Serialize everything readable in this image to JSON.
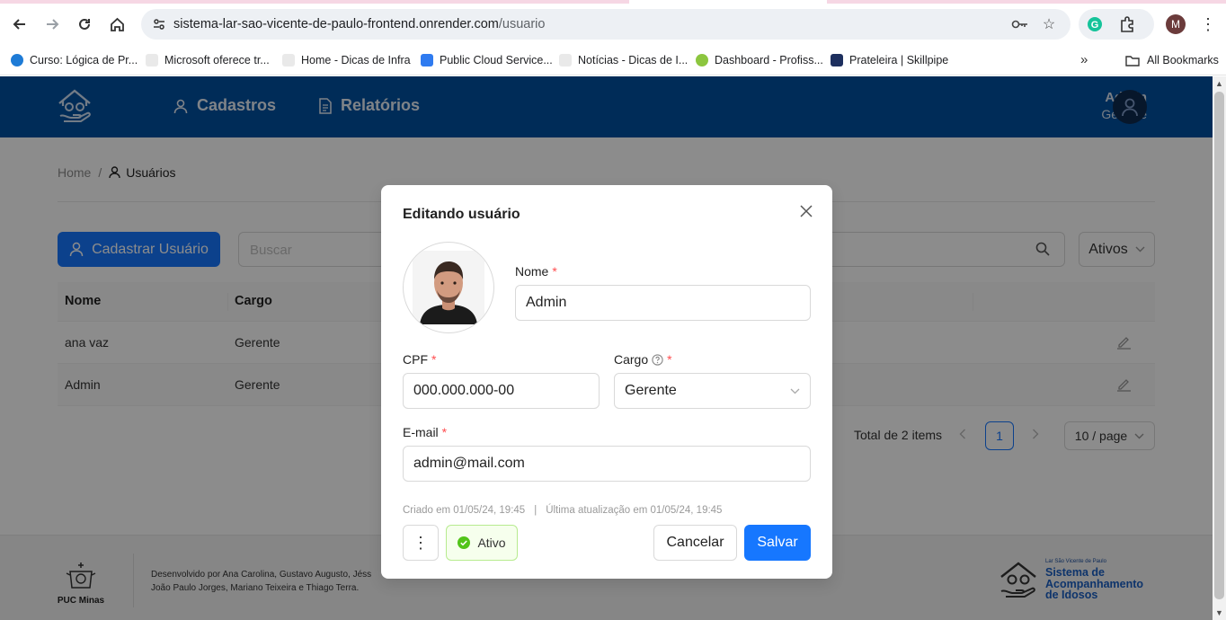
{
  "browser": {
    "url_host": "sistema-lar-sao-vicente-de-paulo-frontend.onrender.com",
    "url_path": "/usuario",
    "profile_initial": "M",
    "bookmarks": [
      {
        "label": "Curso: Lógica de Pr...",
        "color": "#1e7bd6"
      },
      {
        "label": "Microsoft oferece tr...",
        "color": "#e9e9e9"
      },
      {
        "label": "Home - Dicas de Infra",
        "color": "#e9e9e9"
      },
      {
        "label": "Public Cloud Service...",
        "color": "#2f7bf0"
      },
      {
        "label": "Notícias - Dicas de I...",
        "color": "#e9e9e9"
      },
      {
        "label": "Dashboard - Profiss...",
        "color": "#8cc63f"
      },
      {
        "label": "Prateleira | Skillpipe",
        "color": "#1d2f5e"
      }
    ],
    "more_bookmarks": "»",
    "all_bookmarks": "All Bookmarks"
  },
  "header": {
    "nav": [
      {
        "label": "Cadastros"
      },
      {
        "label": "Relatórios"
      }
    ],
    "user_name": "Admin",
    "user_role": "Gerente"
  },
  "breadcrumb": {
    "home": "Home",
    "sep": "/",
    "current": "Usuários"
  },
  "toolbar": {
    "add_label": "Cadastrar Usuário",
    "search_placeholder": "Buscar",
    "filter_value": "Ativos"
  },
  "table": {
    "columns": [
      "Nome",
      "Cargo"
    ],
    "rows": [
      {
        "nome": "ana vaz",
        "cargo": "Gerente"
      },
      {
        "nome": "Admin",
        "cargo": "Gerente"
      }
    ]
  },
  "pagination": {
    "total": "Total de 2 items",
    "current_page": "1",
    "page_size": "10 / page"
  },
  "footer": {
    "puc_label": "PUC Minas",
    "credits_line1": "Desenvolvido por Ana Carolina, Gustavo Augusto, Jéss",
    "credits_line2": "João Paulo Jorges, Mariano Teixeira e Thiago Terra.",
    "brand_small": "Lar São Vicente de Paulo",
    "brand_line1": "Sistema de",
    "brand_line2": "Acompanhamento",
    "brand_line3": "de Idosos"
  },
  "modal": {
    "title": "Editando usuário",
    "nome_label": "Nome",
    "nome_value": "Admin",
    "cpf_label": "CPF",
    "cpf_value": "000.000.000-00",
    "cargo_label": "Cargo",
    "cargo_value": "Gerente",
    "email_label": "E-mail",
    "email_value": "admin@mail.com",
    "required_mark": "*",
    "created": "Criado em 01/05/24, 19:45",
    "meta_sep": "|",
    "updated": "Última atualização em 01/05/24, 19:45",
    "status": "Ativo",
    "cancel_label": "Cancelar",
    "save_label": "Salvar"
  },
  "colors": {
    "header_bg": "#0050a0",
    "primary": "#1677ff",
    "success": "#52c41a",
    "required": "#ff4d4f"
  }
}
